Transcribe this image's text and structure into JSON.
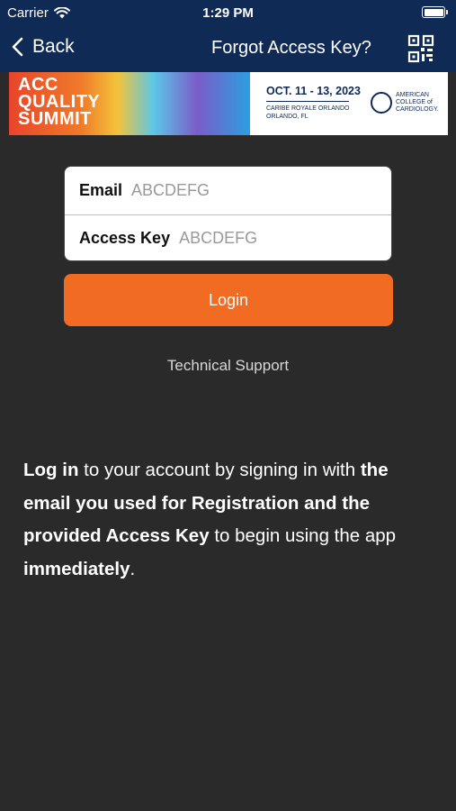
{
  "status_bar": {
    "carrier": "Carrier",
    "time": "1:29 PM"
  },
  "nav": {
    "back_label": "Back",
    "title": "Forgot Access Key?"
  },
  "banner": {
    "title_line1": "ACC",
    "title_line2": "QUALITY",
    "title_line3": "SUMMIT",
    "dates": "OCT. 11 - 13, 2023",
    "venue_line1": "CARIBE ROYALE ORLANDO",
    "venue_line2": "ORLANDO, FL",
    "org_line1": "AMERICAN",
    "org_line2": "COLLEGE of",
    "org_line3": "CARDIOLOGY."
  },
  "form": {
    "email_label": "Email",
    "email_value": "ABCDEFG",
    "access_key_label": "Access Key",
    "access_key_value": "ABCDEFG"
  },
  "login_label": "Login",
  "support_label": "Technical Support",
  "info": {
    "p1": "Log in",
    "p2": " to your account by signing in with ",
    "p3": "the email you used for Registration and the provided Access Key",
    "p4": " to begin using the app ",
    "p5": "immediately",
    "p6": "."
  },
  "colors": {
    "nav_bg": "#0f2a55",
    "accent": "#f26b22",
    "body_bg": "#2a2a2b"
  },
  "icons": [
    "wifi-icon",
    "battery-icon",
    "back-chevron-icon",
    "qr-code-icon"
  ]
}
